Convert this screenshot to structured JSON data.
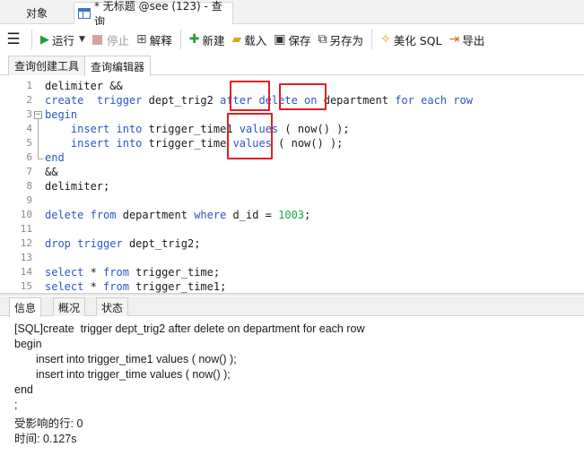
{
  "window_tabs": {
    "objects_label": "对象",
    "query_label": "* 无标题 @see (123) - 查询"
  },
  "toolbar": {
    "menu_icon": "menu-icon",
    "run_label": "运行",
    "stop_label": "停止",
    "explain_label": "解释",
    "new_label": "新建",
    "load_label": "载入",
    "save_label": "保存",
    "save_as_label": "另存为",
    "beautify_label": "美化 SQL",
    "export_label": "导出"
  },
  "sub_tabs": {
    "builder_label": "查询创建工具",
    "editor_label": "查询编辑器"
  },
  "editor": {
    "line_numbers": [
      "1",
      "2",
      "3",
      "4",
      "5",
      "6",
      "7",
      "8",
      "9",
      "10",
      "11",
      "12",
      "13",
      "14",
      "15"
    ],
    "lines": [
      "delimiter &&",
      "create  trigger dept_trig2 after delete on department for each row",
      "begin",
      "    insert into trigger_time1 values ( now() );",
      "    insert into trigger_time values ( now() );",
      "end",
      "&&",
      "delimiter;",
      "",
      "delete from department where d_id = 1003;",
      "",
      "drop trigger dept_trig2;",
      "",
      "select * from trigger_time;",
      "select * from trigger_time1;"
    ]
  },
  "bottom_tabs": {
    "info_label": "信息",
    "overview_label": "概况",
    "status_label": "状态"
  },
  "output": {
    "lines": [
      "[SQL]create  trigger dept_trig2 after delete on department for each row",
      "begin",
      "insert into trigger_time1 values ( now() );",
      "insert into trigger_time values ( now() );",
      "end",
      ";",
      "受影响的行: 0",
      "时间: 0.127s"
    ]
  },
  "colors": {
    "keyword": "#2a56c6",
    "number": "#1aa050",
    "highlight_box": "#e02020",
    "run_icon": "#1e9e3a"
  }
}
